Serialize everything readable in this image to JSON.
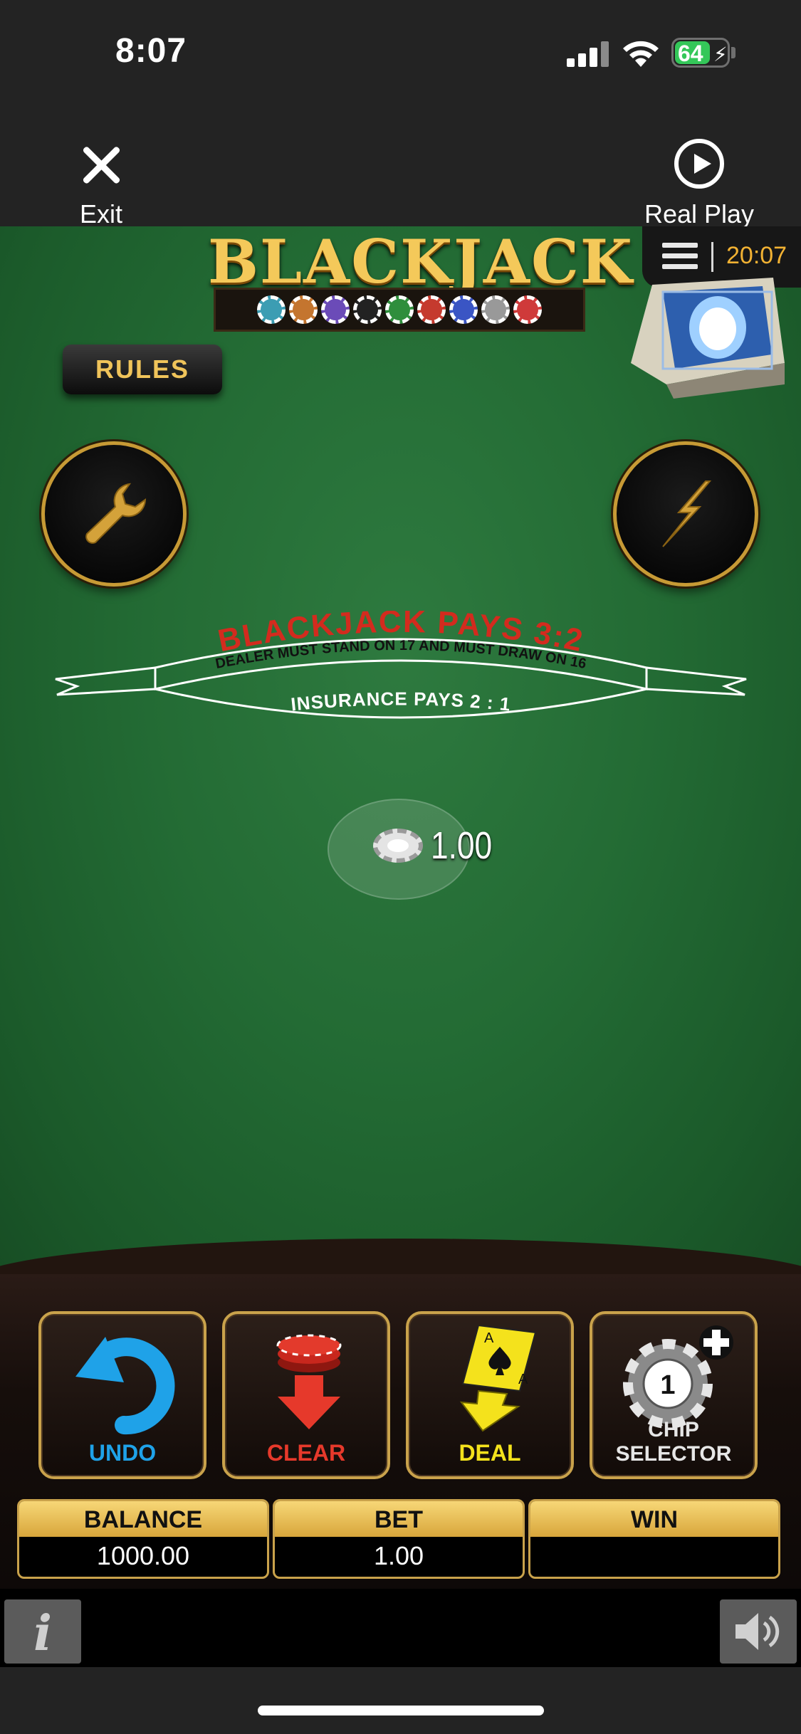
{
  "status_bar": {
    "time": "8:07",
    "battery": "64",
    "battery_level_percent": 64,
    "charging": true
  },
  "nav": {
    "exit_label": "Exit",
    "real_play_label": "Real Play"
  },
  "game": {
    "title": "BLACKJACK",
    "rules_label": "RULES",
    "clock": "20:07",
    "banner": {
      "pays": "BLACKJACK PAYS 3:2",
      "dealer_rule": "DEALER MUST STAND ON 17 AND MUST DRAW ON 16",
      "insurance": "INSURANCE PAYS 2 : 1"
    },
    "current_bet_chip": "1.00"
  },
  "controls": {
    "undo_label": "UNDO",
    "clear_label": "CLEAR",
    "deal_label": "DEAL",
    "chip_selector_label": "CHIP SELECTOR",
    "chip_value": "1",
    "card_rank": "A"
  },
  "stats": {
    "balance_label": "BALANCE",
    "balance_value": "1000.00",
    "bet_label": "BET",
    "bet_value": "1.00",
    "win_label": "WIN",
    "win_value": ""
  },
  "icons": {
    "info": "info-icon",
    "sound": "speaker-icon",
    "settings": "wrench-icon",
    "turbo": "lightning-icon"
  },
  "colors": {
    "felt": "#236b34",
    "gold": "#c9a24b",
    "undo": "#1fa2e8",
    "clear": "#e6392b",
    "deal": "#f4e21c",
    "clock": "#f2b233"
  }
}
